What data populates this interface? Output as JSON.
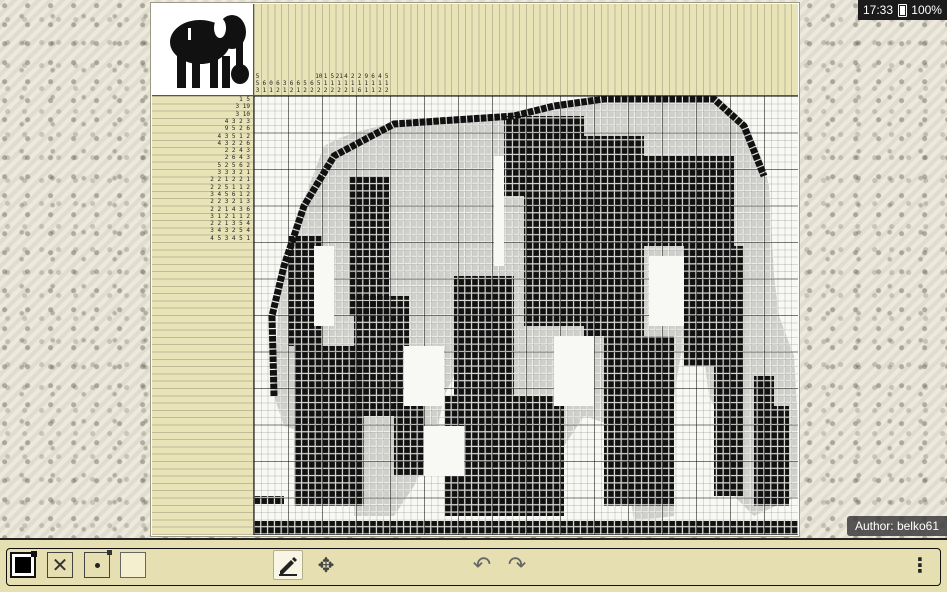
{
  "status": {
    "time": "17:33",
    "battery": "100%"
  },
  "author": "Author: belko61",
  "toolbar": {
    "fill_tool": "fill-icon",
    "cross_tool": "cross-icon",
    "dot_tool": "dot-icon",
    "empty_tool": "empty-square-icon",
    "pen_tool": "pencil-icon",
    "move_tool": "move-icon",
    "undo": "undo-arrow-icon",
    "redo": "redo-arrow-icon",
    "menu": "more-vert-icon"
  },
  "puzzle": {
    "col_clue_sample": [
      [
        "5",
        "5",
        "3"
      ],
      [
        "6",
        "1"
      ],
      [
        "0",
        "1"
      ],
      [
        "6",
        "2"
      ],
      [
        "3",
        "1"
      ],
      [
        "6",
        "2"
      ],
      [
        "6",
        "1"
      ],
      [
        "5",
        "2"
      ],
      [
        "6",
        "2"
      ],
      [
        "10",
        "5",
        "2"
      ],
      [
        "1",
        "1",
        "2"
      ],
      [
        "5",
        "1",
        "2"
      ],
      [
        "21",
        "1",
        "2"
      ],
      [
        "4",
        "1",
        "2"
      ],
      [
        "2",
        "1",
        "1"
      ],
      [
        "2",
        "1",
        "6"
      ],
      [
        "9",
        "1",
        "1"
      ],
      [
        "6",
        "1",
        "1"
      ],
      [
        "4",
        "1",
        "2"
      ],
      [
        "5",
        "1",
        "2"
      ]
    ],
    "row_clue_sample": [
      "1 5",
      "3 19",
      "3 10",
      "4 3 2 3",
      "9 5 2 6",
      "4 3 5 1 2",
      "4 3 2 2 6",
      "2 2 4 3",
      "2 6 4 3",
      "5 2 5 6 2",
      "3 3 3 2 1",
      "2 2 1 2 2 1",
      "2 2 5 1 1 2",
      "3 4 5 6 1 2",
      "2 2 3 2 1 3",
      "2 2 1 4 3 6",
      "3 1 2 1 1 2",
      "2 2 1 3 5 4",
      "3 4 3 2 5 4",
      "4 5 3 4 5 1"
    ]
  }
}
